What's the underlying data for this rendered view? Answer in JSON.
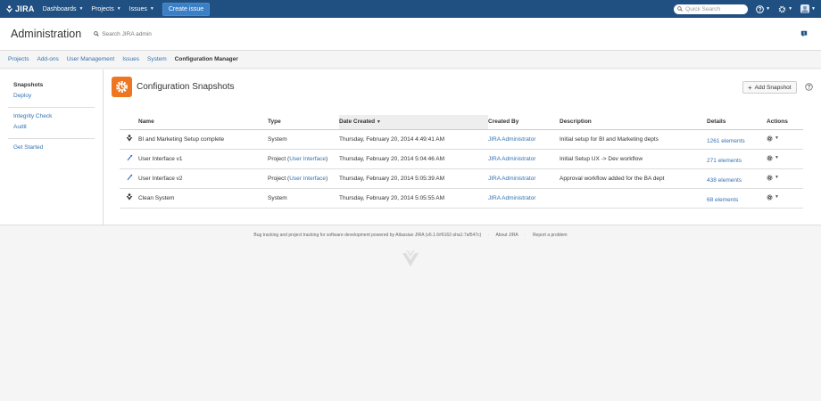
{
  "topnav": {
    "logo": "JIRA",
    "items": [
      {
        "label": "Dashboards"
      },
      {
        "label": "Projects"
      },
      {
        "label": "Issues"
      }
    ],
    "create_label": "Create issue",
    "quick_search_placeholder": "Quick Search"
  },
  "header": {
    "title": "Administration",
    "search_placeholder": "Search JIRA admin"
  },
  "admin_tabs": [
    "Projects",
    "Add-ons",
    "User Management",
    "Issues",
    "System",
    "Configuration Manager"
  ],
  "sidebar": {
    "groups": [
      [
        "Snapshots",
        "Deploy"
      ],
      [
        "Integrity Check",
        "Audit"
      ],
      [
        "Get Started"
      ]
    ]
  },
  "page": {
    "title": "Configuration Snapshots",
    "add_button": "Add Snapshot"
  },
  "table": {
    "headers": {
      "name": "Name",
      "type": "Type",
      "date": "Date Created",
      "created_by": "Created By",
      "description": "Description",
      "details": "Details",
      "actions": "Actions"
    },
    "rows": [
      {
        "icon": "system",
        "name": "BI and Marketing Setup complete",
        "type": "System",
        "type_project": "",
        "date": "Thursday, February 20, 2014 4:49:41 AM",
        "created_by": "JIRA Administrator",
        "description": "Initial setup for BI and Marketing depts",
        "details": "1261 elements"
      },
      {
        "icon": "project",
        "name": "User Interface v1",
        "type": "Project (",
        "type_project": "User Interface",
        "date": "Thursday, February 20, 2014 5:04:46 AM",
        "created_by": "JIRA Administrator",
        "description": "Initial Setup UX -> Dev workflow",
        "details": "271 elements"
      },
      {
        "icon": "project",
        "name": "User Interface v2",
        "type": "Project (",
        "type_project": "User Interface",
        "date": "Thursday, February 20, 2014 5:05:39 AM",
        "created_by": "JIRA Administrator",
        "description": "Approval workflow added for the BA dept",
        "details": "438 elements"
      },
      {
        "icon": "system",
        "name": "Clean System",
        "type": "System",
        "type_project": "",
        "date": "Thursday, February 20, 2014 5:05:55 AM",
        "created_by": "JIRA Administrator",
        "description": "",
        "details": "68 elements"
      }
    ]
  },
  "footer": {
    "text": "Bug tracking and project tracking for software development powered by Atlassian JIRA (v6.1.6#6162-sha1:7af547c)",
    "about": "About JIRA",
    "report": "Report a problem"
  },
  "colors": {
    "nav_bg": "#205081",
    "link": "#3572b0",
    "plugin_icon": "#ee7621"
  }
}
